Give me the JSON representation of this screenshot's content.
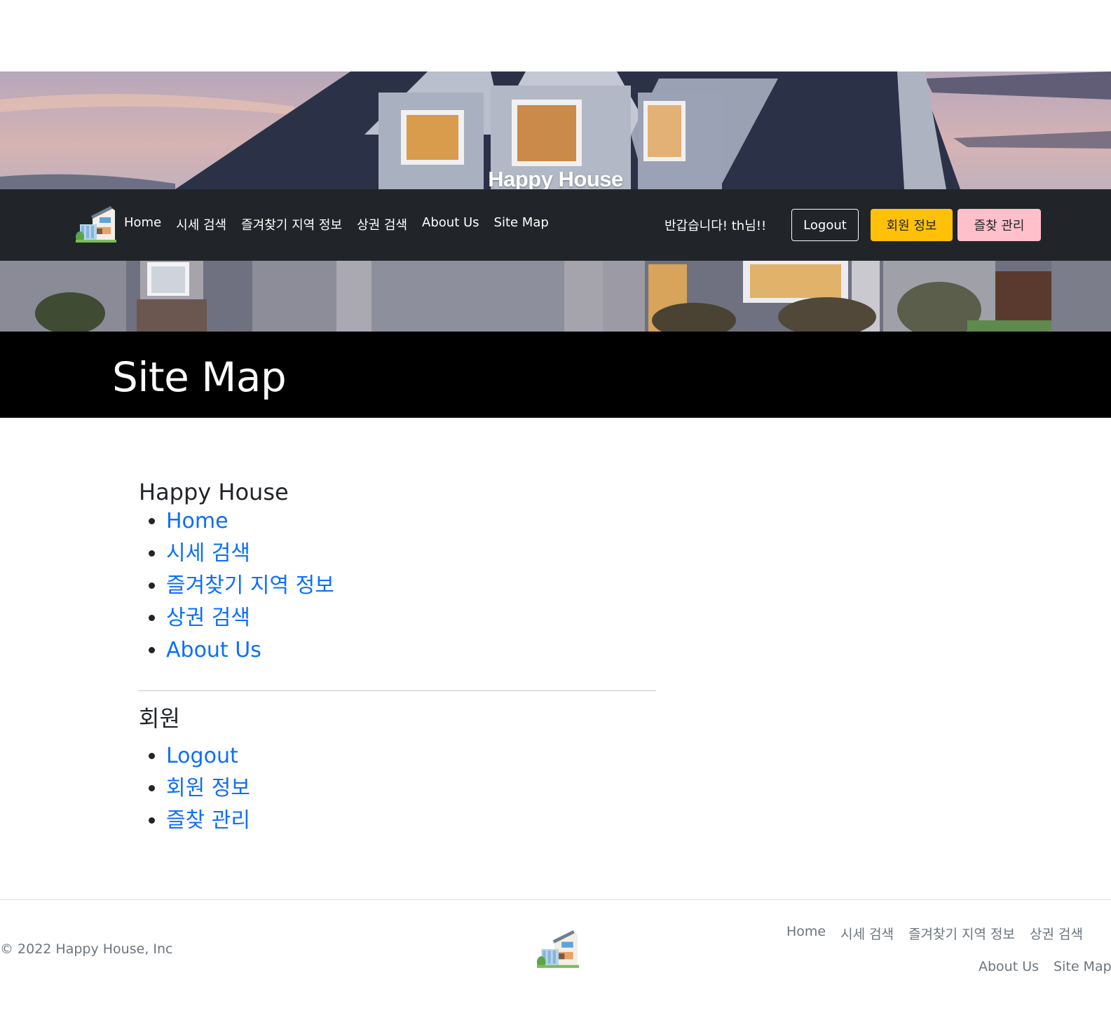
{
  "hero": {
    "title": "Happy House"
  },
  "navbar": {
    "links": [
      "Home",
      "시세 검색",
      "즐겨찾기 지역 정보",
      "상권 검색",
      "About Us",
      "Site Map"
    ],
    "greeting": "반갑습니다! th님!!",
    "logout_label": "Logout",
    "member_info_label": "회원 정보",
    "favorites_label": "즐찾 관리"
  },
  "page": {
    "title": "Site Map"
  },
  "sitemap": {
    "sections": [
      {
        "heading": "Happy House",
        "items": [
          "Home",
          "시세 검색",
          "즐겨찾기 지역 정보",
          "상권 검색",
          "About Us"
        ]
      },
      {
        "heading": "회원",
        "items": [
          "Logout",
          "회원 정보",
          "즐찾 관리"
        ]
      }
    ]
  },
  "footer": {
    "copyright": "© 2022 Happy House, Inc",
    "links_row1": [
      "Home",
      "시세 검색",
      "즐겨찾기 지역 정보",
      "상권 검색"
    ],
    "links_row2": [
      "About Us",
      "Site Map"
    ]
  },
  "colors": {
    "navbar_bg": "#212529",
    "link": "#0d6efd",
    "member_button": "#ffc107",
    "favorites_button": "#ffc0cb",
    "title_band": "#000000"
  }
}
